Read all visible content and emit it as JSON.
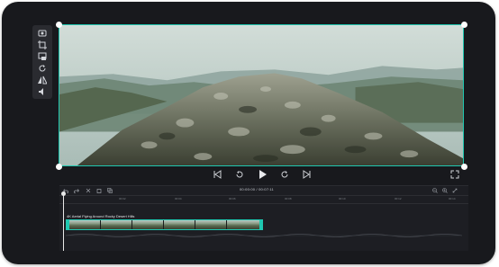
{
  "preview": {
    "alt": "Aerial shot of a rocky hilltop with distant mountains"
  },
  "toolbar": {
    "tools": [
      "screenshot-icon",
      "crop-icon",
      "resize-icon",
      "rotate-icon",
      "flip-icon",
      "volume-icon"
    ]
  },
  "playback": {
    "prev_label": "prev-frame",
    "rewind_label": "5",
    "forward_label": "5"
  },
  "timeline": {
    "timecode": "00:00:00 / 00:07:11",
    "ruler_ticks": [
      "00:02",
      "00:04",
      "00:06",
      "00:08",
      "00:10",
      "00:12",
      "00:14"
    ],
    "clip_title": "4K Aerial Flying Around Rocky Desert Hills"
  },
  "colors": {
    "accent": "#1fc7b0",
    "background": "#18191d"
  }
}
